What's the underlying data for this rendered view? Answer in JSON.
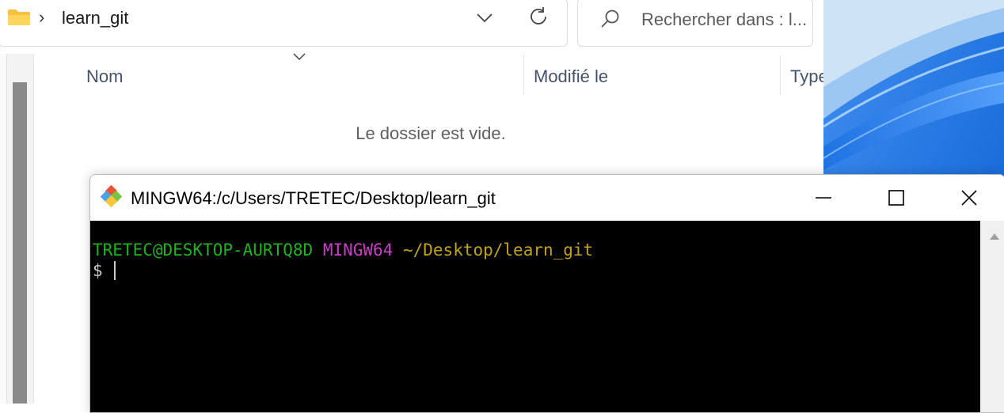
{
  "explorer": {
    "breadcrumb": {
      "chevron": "›",
      "folder": "learn_git"
    },
    "search": {
      "placeholder": "Rechercher dans : l..."
    },
    "columns": [
      "Nom",
      "Modifié le",
      "Type"
    ],
    "empty_message": "Le dossier est vide.",
    "icons": [
      "folder-icon",
      "chevron-down-icon",
      "refresh-icon",
      "search-icon",
      "sort-chevron-icon"
    ]
  },
  "terminal": {
    "title": "MINGW64:/c/Users/TRETEC/Desktop/learn_git",
    "prompt": {
      "user_host": "TRETEC@DESKTOP-AURTQ8D",
      "system": "MINGW64",
      "path": "~/Desktop/learn_git",
      "symbol": "$"
    },
    "colors": {
      "user_host": "#1fb21f",
      "system": "#c540c5",
      "path": "#c1a217",
      "background": "#000000"
    },
    "window_controls": [
      "minimize-icon",
      "maximize-icon",
      "close-icon"
    ]
  }
}
